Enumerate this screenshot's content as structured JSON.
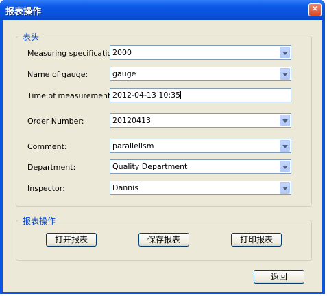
{
  "window": {
    "title": "报表操作",
    "close_glyph": "✕"
  },
  "header_group": {
    "title": "表头",
    "fields": [
      {
        "label": "Measuring specification:",
        "value": "2000",
        "type": "combo"
      },
      {
        "label": "Name of gauge:",
        "value": "gauge",
        "type": "combo"
      },
      {
        "label": "Time of measurement:",
        "value": "2012-04-13 10:35",
        "type": "text"
      },
      {
        "label": "Order Number:",
        "value": "20120413",
        "type": "combo"
      },
      {
        "label": "Comment:",
        "value": "parallelism",
        "type": "combo"
      },
      {
        "label": "Department:",
        "value": "Quality Department",
        "type": "combo"
      },
      {
        "label": "Inspector:",
        "value": "Dannis",
        "type": "combo"
      }
    ]
  },
  "actions_group": {
    "title": "报表操作",
    "open_label": "打开报表",
    "save_label": "保存报表",
    "print_label": "打印报表"
  },
  "back_label": "返回",
  "icons": {
    "dropdown_arrow": "chevron-down-icon",
    "close": "close-icon"
  }
}
